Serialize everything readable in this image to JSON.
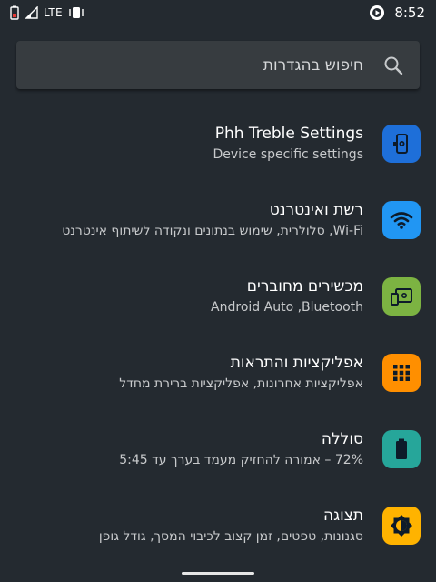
{
  "status_bar": {
    "network": "LTE",
    "time": "8:52"
  },
  "search": {
    "placeholder": "חיפוש בהגדרות"
  },
  "settings": [
    {
      "title": "Phh Treble Settings",
      "subtitle": "Device specific settings",
      "icon": "phone-settings-icon",
      "color": "#1e6fd9"
    },
    {
      "title": "רשת ואינטרנט",
      "subtitle": "Wi-Fi, סלולרית, שימוש בנתונים ונקודה לשיתוף אינטרנט",
      "icon": "wifi-icon",
      "color": "#2196f3"
    },
    {
      "title": "מכשירים מחוברים",
      "subtitle": "Android Auto ,Bluetooth",
      "icon": "connected-devices-icon",
      "color": "#7cb342"
    },
    {
      "title": "אפליקציות והתראות",
      "subtitle": "אפליקציות אחרונות, אפליקציות ברירת מחדל",
      "icon": "apps-grid-icon",
      "color": "#ff8f00"
    },
    {
      "title": "סוללה",
      "subtitle": "72% – אמורה להחזיק מעמד בערך עד 5:45",
      "icon": "battery-icon",
      "color": "#26a69a"
    },
    {
      "title": "תצוגה",
      "subtitle": "סגנונות, טפטים, זמן קצוב לכיבוי המסך, גודל גופן",
      "icon": "brightness-icon",
      "color": "#ffb300"
    }
  ]
}
